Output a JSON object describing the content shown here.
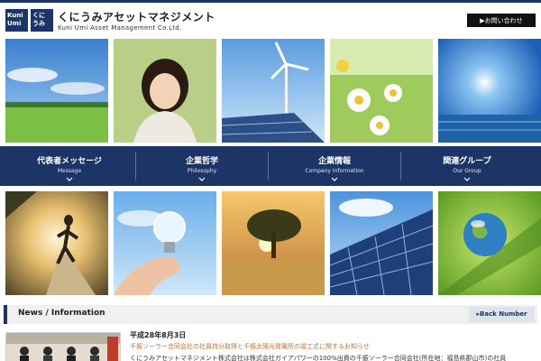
{
  "header": {
    "logo_box_a": "Kuni Umi",
    "logo_box_b": "くに うみ",
    "company_name": "くにうみアセットマネジメント",
    "company_name_en": "Kuni Umi Asset Management Co.Ltd.",
    "contact_button": "▶お問い合わせ"
  },
  "nav": {
    "items": [
      {
        "label": "代表者メッセージ",
        "sub": "Message"
      },
      {
        "label": "企業哲学",
        "sub": "Philosophy"
      },
      {
        "label": "企業情報",
        "sub": "Company Information"
      },
      {
        "label": "関連グループ",
        "sub": "Our Group"
      }
    ]
  },
  "news": {
    "section_title": "News / Information",
    "back_button": "▸Back Number",
    "date": "平成28年8月3日",
    "headline": "千振ソーラー合同会社の社員持分取得と千振太陽光発電所の竣工式に関するお知らせ",
    "body": "くにうみアセットマネジメント株式会社は株式会社ガイアパワーの100%出資の千振ソーラー合同会社(所在地：福島県郡山市)の社員"
  },
  "colors": {
    "brand": "#1c3466",
    "accent": "#c8702a",
    "button_dark": "#111111"
  },
  "photos": {
    "row1": [
      "sky-meadow-photo",
      "child-photo",
      "wind-turbine-solar-photo",
      "daisy-flowers-photo",
      "ocean-sun-photo"
    ],
    "row2": [
      "running-woman-photo",
      "lightbulb-hand-photo",
      "tree-sunset-photo",
      "solar-panels-photo",
      "globe-droplet-photo"
    ]
  }
}
